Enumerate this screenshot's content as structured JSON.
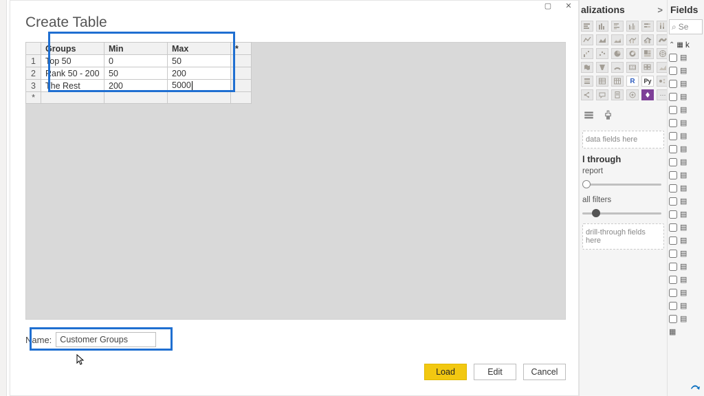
{
  "dialog": {
    "title": "Create Table",
    "window_controls": {
      "maximize": "▢",
      "close": "✕"
    },
    "name_label": "Name:",
    "name_value": "Customer Groups",
    "buttons": {
      "load": "Load",
      "edit": "Edit",
      "cancel": "Cancel"
    }
  },
  "table": {
    "columns": [
      "Groups",
      "Min",
      "Max"
    ],
    "star_header": "*",
    "new_row_marker": "*",
    "rows": [
      {
        "n": "1",
        "groups": "Top 50",
        "min": "0",
        "max": "50"
      },
      {
        "n": "2",
        "groups": "Rank 50 - 200",
        "min": "50",
        "max": "200"
      },
      {
        "n": "3",
        "groups": "The Rest",
        "min": "200",
        "max": "5000"
      }
    ]
  },
  "visualizations": {
    "title": "alizations",
    "chevron": ">",
    "well_values": "data fields here",
    "drill_header": "l through",
    "drill_report": "report",
    "drill_filters": "all filters",
    "well_drill": "drill-through fields here"
  },
  "fields": {
    "title": "Fields",
    "search_icon": "⌕",
    "search_placeholder": "Se",
    "tree_table_label": "k"
  },
  "chart_data": {
    "type": "table",
    "columns": [
      "Groups",
      "Min",
      "Max"
    ],
    "rows": [
      [
        "Top 50",
        0,
        50
      ],
      [
        "Rank 50 - 200",
        50,
        200
      ],
      [
        "The Rest",
        200,
        5000
      ]
    ]
  }
}
